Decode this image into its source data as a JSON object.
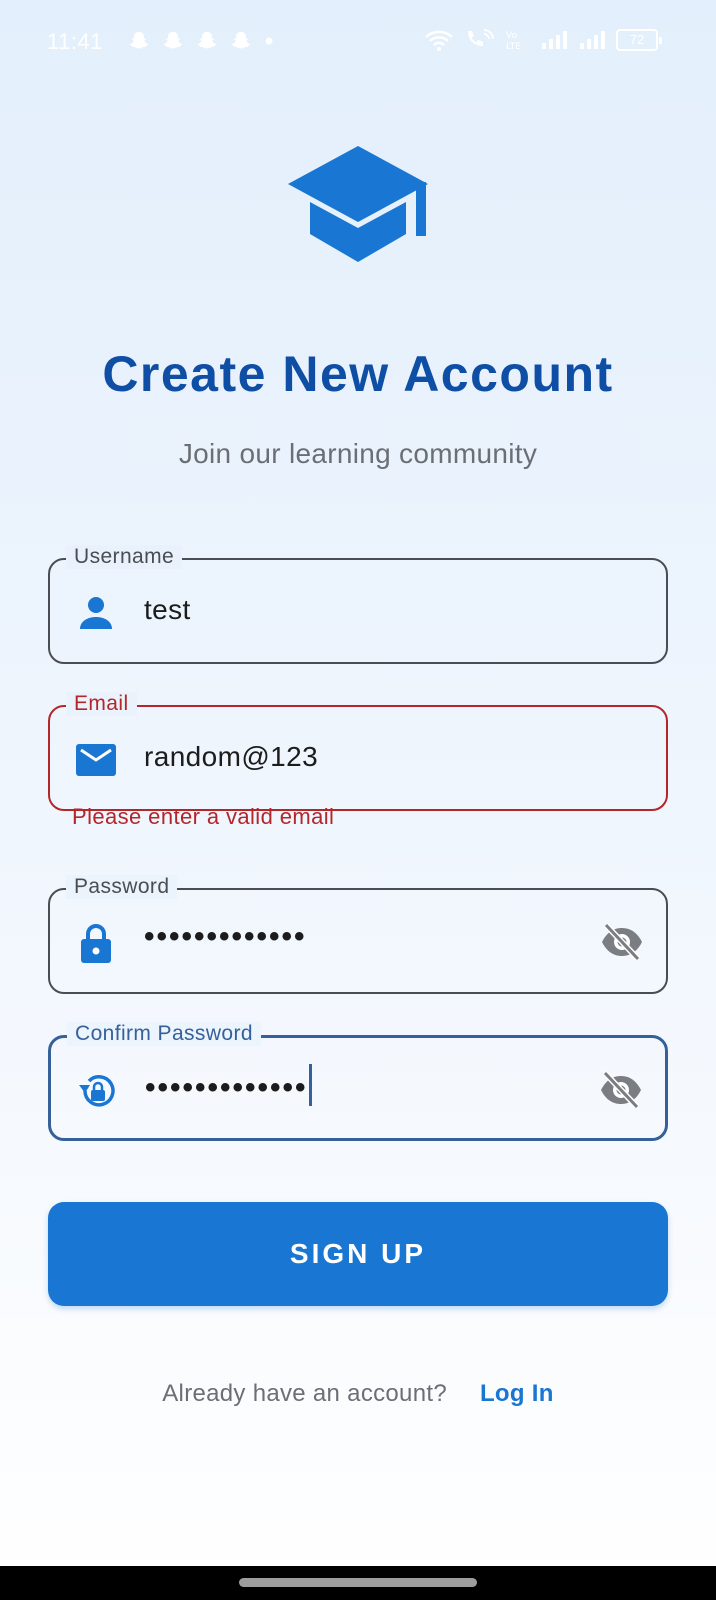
{
  "status_bar": {
    "time": "11:41",
    "battery": "72",
    "notification_icons": [
      "snapchat-icon",
      "snapchat-icon",
      "snapchat-icon",
      "snapchat-icon",
      "dot-icon"
    ],
    "right_icons": [
      "wifi-icon",
      "wifi-calling-icon",
      "volte-icon",
      "signal-icon",
      "signal-icon",
      "battery-icon"
    ]
  },
  "logo": {
    "icon": "graduation-cap-icon",
    "color": "#1976d2"
  },
  "header": {
    "title": "Create New Account",
    "subtitle": "Join our learning community"
  },
  "form": {
    "username": {
      "label": "Username",
      "value": "test",
      "icon": "person-icon"
    },
    "email": {
      "label": "Email",
      "value": "random@123",
      "icon": "mail-icon",
      "error": "Please enter a valid email"
    },
    "password": {
      "label": "Password",
      "value": "•••••••••••••",
      "icon": "lock-icon",
      "toggle_icon": "visibility-off-icon"
    },
    "confirm_password": {
      "label": "Confirm Password",
      "value": "•••••••••••••",
      "icon": "lock-reset-icon",
      "toggle_icon": "visibility-off-icon"
    }
  },
  "actions": {
    "signup_label": "SIGN UP",
    "login_prompt": "Already have an account?",
    "login_link": "Log In"
  },
  "colors": {
    "primary": "#1976d2",
    "title": "#0f4ea5",
    "error": "#b3262a",
    "focus": "#35609a"
  }
}
